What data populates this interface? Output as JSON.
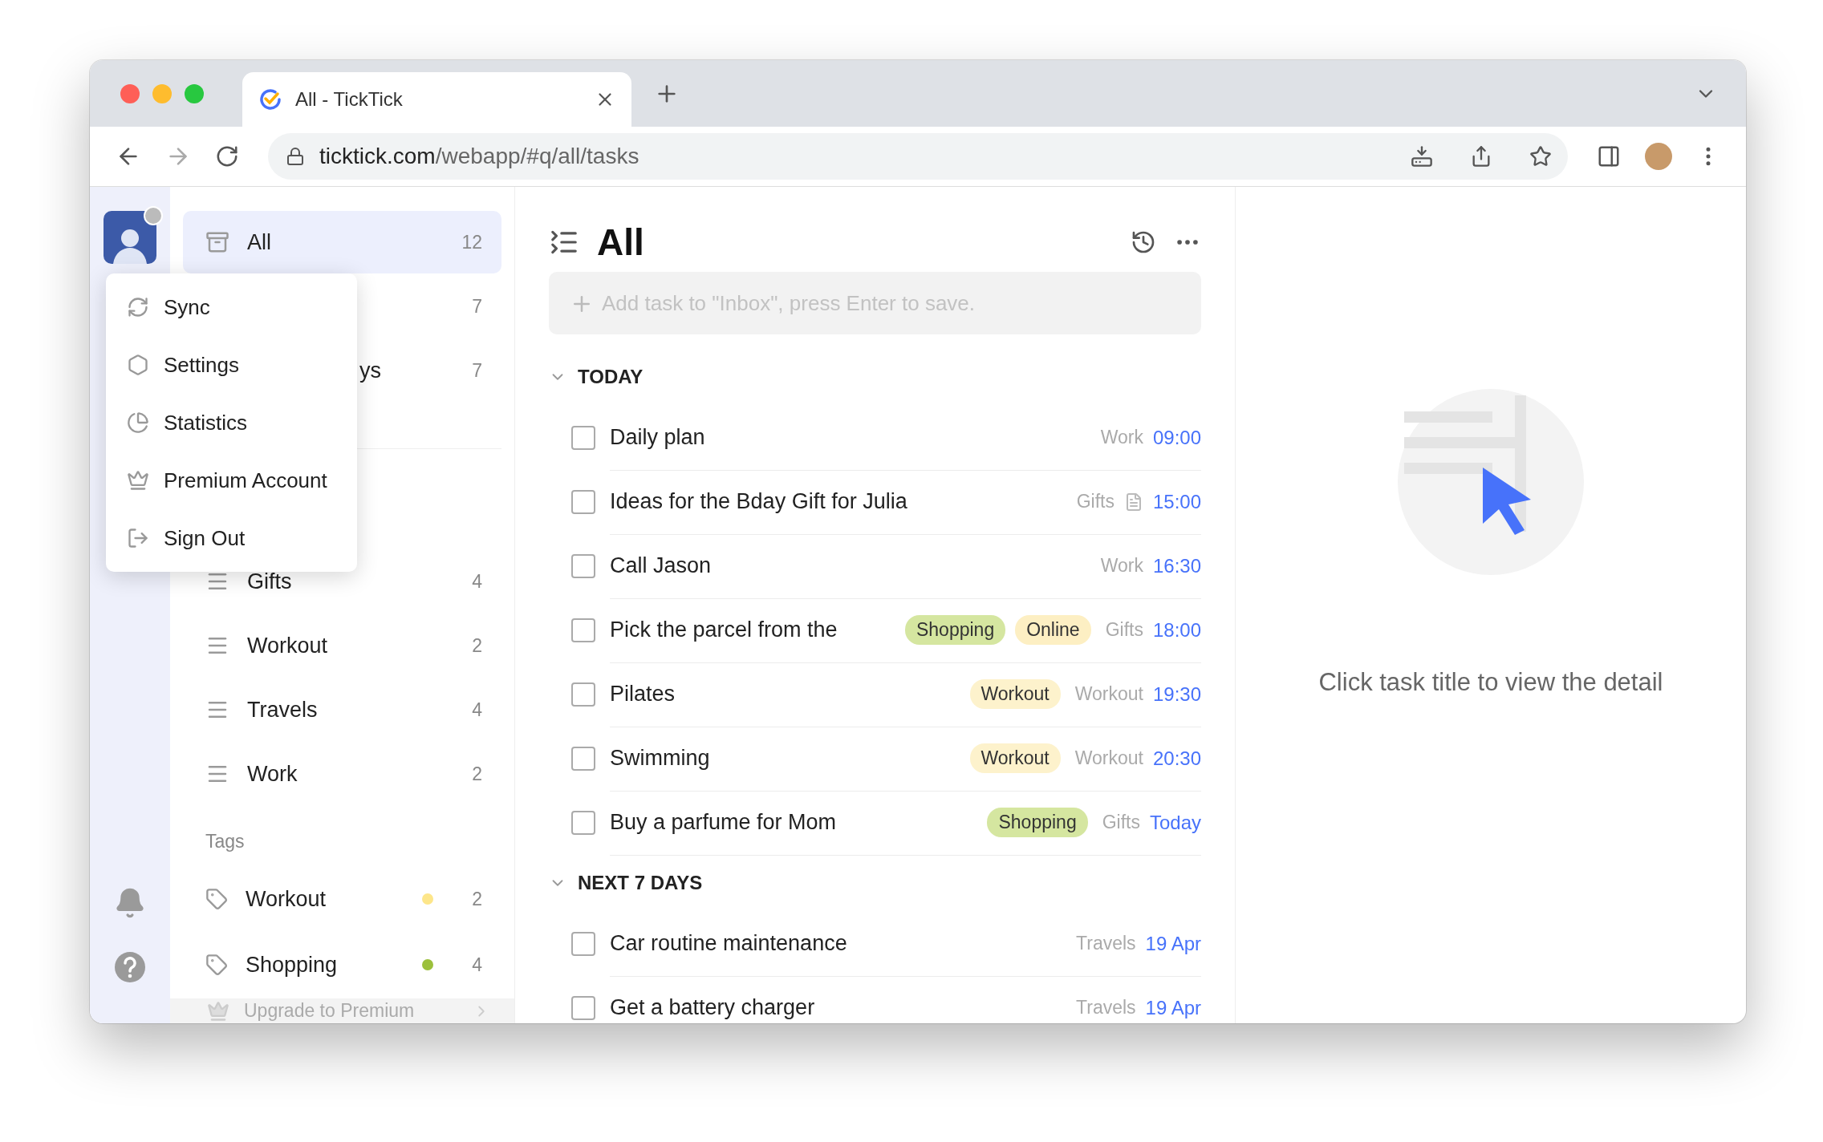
{
  "browser": {
    "tab_title": "All - TickTick",
    "url_host": "ticktick.com",
    "url_path": "/webapp/#q/all/tasks"
  },
  "sidebar": {
    "smart_lists": [
      {
        "label": "All",
        "count": "12",
        "selected": true
      },
      {
        "count": "7",
        "selected": false
      },
      {
        "label_fragment": "ys",
        "count": "7",
        "selected": false
      }
    ],
    "lists": [
      {
        "label": "Gifts",
        "count": "4"
      },
      {
        "label": "Workout",
        "count": "2"
      },
      {
        "label": "Travels",
        "count": "4"
      },
      {
        "label": "Work",
        "count": "2"
      }
    ],
    "tags_heading": "Tags",
    "tags": [
      {
        "label": "Workout",
        "color": "#fde68a",
        "count": "2"
      },
      {
        "label": "Shopping",
        "color": "#9cc03c",
        "count": "4"
      }
    ],
    "upgrade": "Upgrade to Premium"
  },
  "account_menu": [
    {
      "label": "Sync",
      "kind": "sync"
    },
    {
      "label": "Settings",
      "kind": "settings"
    },
    {
      "label": "Statistics",
      "kind": "statistics"
    },
    {
      "label": "Premium Account",
      "kind": "premium"
    },
    {
      "label": "Sign Out",
      "kind": "signout"
    }
  ],
  "task_list": {
    "title": "All",
    "add_placeholder": "Add task to \"Inbox\", press Enter to save.",
    "sections": [
      {
        "title": "TODAY",
        "expanded": true,
        "tasks": [
          {
            "title": "Daily plan",
            "checked": false,
            "list": "Work",
            "due": "09:00"
          },
          {
            "title": "Ideas for the Bday Gift for Julia",
            "checked": false,
            "list": "Gifts",
            "has_note": true,
            "due": "15:00"
          },
          {
            "title": "Call Jason",
            "checked": false,
            "list": "Work",
            "due": "16:30"
          },
          {
            "title": "Pick the parcel from the",
            "checked": false,
            "tags": [
              {
                "label": "Shopping",
                "color": "#d5e6a0"
              },
              {
                "label": "Online",
                "color": "#fdefc3"
              }
            ],
            "list": "Gifts",
            "due": "18:00"
          },
          {
            "title": "Pilates",
            "checked": false,
            "tags": [
              {
                "label": "Workout",
                "color": "#fdf2cc"
              }
            ],
            "list": "Workout",
            "due": "19:30"
          },
          {
            "title": "Swimming",
            "checked": false,
            "tags": [
              {
                "label": "Workout",
                "color": "#fdf2cc"
              }
            ],
            "list": "Workout",
            "due": "20:30"
          },
          {
            "title": "Buy a parfume for Mom",
            "checked": false,
            "tags": [
              {
                "label": "Shopping",
                "color": "#d5e6a0"
              }
            ],
            "list": "Gifts",
            "due": "Today"
          }
        ]
      },
      {
        "title": "NEXT 7 DAYS",
        "expanded": true,
        "tasks": [
          {
            "title": "Car routine maintenance",
            "checked": false,
            "list": "Travels",
            "due": "19 Apr"
          },
          {
            "title": "Get a battery charger",
            "checked": false,
            "list": "Travels",
            "due": "19 Apr"
          }
        ]
      }
    ]
  },
  "detail": {
    "hint": "Click task title to view the detail"
  }
}
